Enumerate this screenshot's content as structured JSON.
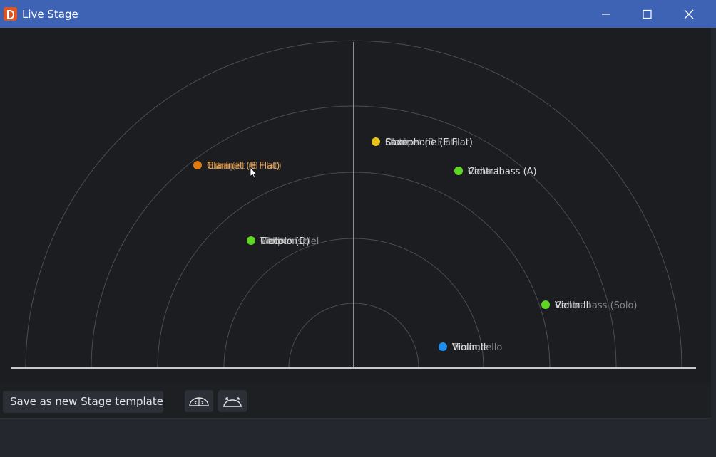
{
  "window": {
    "title": "Live Stage",
    "app_icon": "app-logo-icon",
    "controls": [
      "minimize-icon",
      "maximize-icon",
      "close-icon"
    ]
  },
  "stage": {
    "ring_count": 5,
    "positions": [
      {
        "color": "#e07a10",
        "label_color": "#e8a458",
        "labels": [
          "Trumpet (B Flat)",
          "Tuba",
          "Horn (F)",
          "Clarinet (B Flat)"
        ]
      },
      {
        "color": "#e6c21a",
        "label_color": "#dcdcdc",
        "labels": [
          "Clarinet (B Flat)",
          "Flute",
          "Oboe",
          "Saxophone (E Flat)"
        ]
      },
      {
        "color": "#5fd622",
        "label_color": "#dcdcdc",
        "labels": [
          "Cello",
          "Violin II",
          "Viola",
          "Contrabass (A)"
        ]
      },
      {
        "color": "#5fd622",
        "label_color": "#dcdcdc",
        "labels": [
          "Cello",
          "Violin I",
          "Timpani",
          "Glockenspiel",
          "Piccolo (D)"
        ]
      },
      {
        "color": "#5fd622",
        "label_color": "#dcdcdc",
        "labels": [
          "Violin II",
          "Cello",
          "Contrabass (Solo)",
          "Violin III"
        ]
      },
      {
        "color": "#1e8fef",
        "label_color": "#dcdcdc",
        "labels": [
          "Violin I",
          "Triangle",
          "Violoncello",
          "Violin II"
        ]
      }
    ]
  },
  "toolbar": {
    "save_label": "Save as new Stage template",
    "tool_icons": [
      "stage-front-view-icon",
      "stage-back-view-icon"
    ]
  }
}
